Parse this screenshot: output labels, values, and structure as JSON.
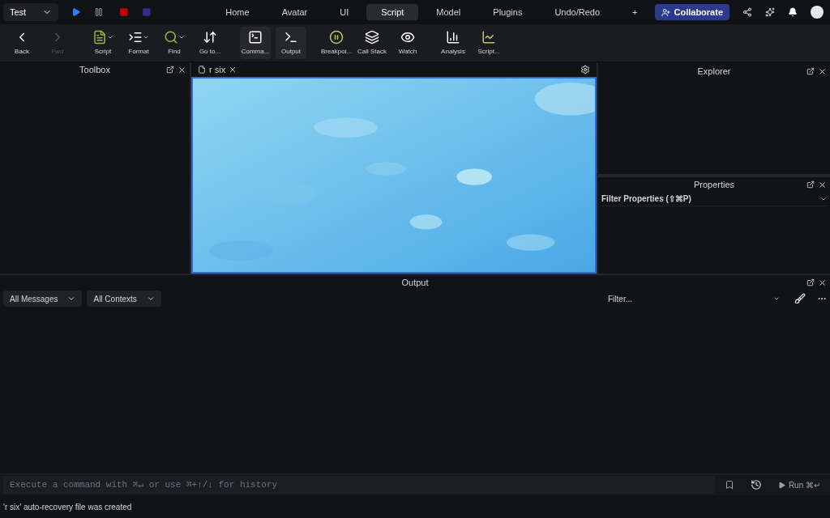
{
  "topbar": {
    "place": "Test",
    "menu_tabs": [
      {
        "label": "Home",
        "selected": false
      },
      {
        "label": "Avatar",
        "selected": false
      },
      {
        "label": "UI",
        "selected": false
      },
      {
        "label": "Script",
        "selected": true
      },
      {
        "label": "Model",
        "selected": false
      },
      {
        "label": "Plugins",
        "selected": false
      },
      {
        "label": "Undo/Redo",
        "selected": false
      },
      {
        "label": "+",
        "selected": false
      }
    ],
    "collaborate": "Collaborate"
  },
  "ribbon": [
    {
      "label": "Back",
      "disabled": false,
      "active": false,
      "caret": false
    },
    {
      "label": "Fwd",
      "disabled": true,
      "active": false,
      "caret": false
    },
    {
      "label": "Script",
      "disabled": false,
      "active": false,
      "caret": true
    },
    {
      "label": "Format",
      "disabled": false,
      "active": false,
      "caret": true
    },
    {
      "label": "Find",
      "disabled": false,
      "active": false,
      "caret": true
    },
    {
      "label": "Go to...",
      "disabled": false,
      "active": false,
      "caret": false
    },
    {
      "label": "Comma...",
      "disabled": false,
      "active": true,
      "caret": false
    },
    {
      "label": "Output",
      "disabled": false,
      "active": true,
      "caret": false
    },
    {
      "label": "Breakpoi...",
      "disabled": false,
      "active": false,
      "caret": false
    },
    {
      "label": "Call Stack",
      "disabled": false,
      "active": false,
      "caret": false
    },
    {
      "label": "Watch",
      "disabled": false,
      "active": false,
      "caret": false
    },
    {
      "label": "Analysis",
      "disabled": false,
      "active": false,
      "caret": false
    },
    {
      "label": "Script...",
      "disabled": false,
      "active": false,
      "caret": false
    }
  ],
  "toolbox": {
    "title": "Toolbox"
  },
  "editor": {
    "tab": "r six"
  },
  "explorer": {
    "title": "Explorer"
  },
  "properties": {
    "title": "Properties",
    "filter_placeholder": "Filter Properties (⇧⌘P)"
  },
  "output": {
    "title": "Output",
    "dropdowns": [
      "All Messages",
      "All Contexts"
    ],
    "filter_placeholder": "Filter..."
  },
  "command_bar": {
    "placeholder": "Execute a command with ⌘↵ or use ⌘+↑/↓ for history",
    "run": "Run ⌘↵"
  },
  "status_bar": "'r six' auto-recovery file was created"
}
